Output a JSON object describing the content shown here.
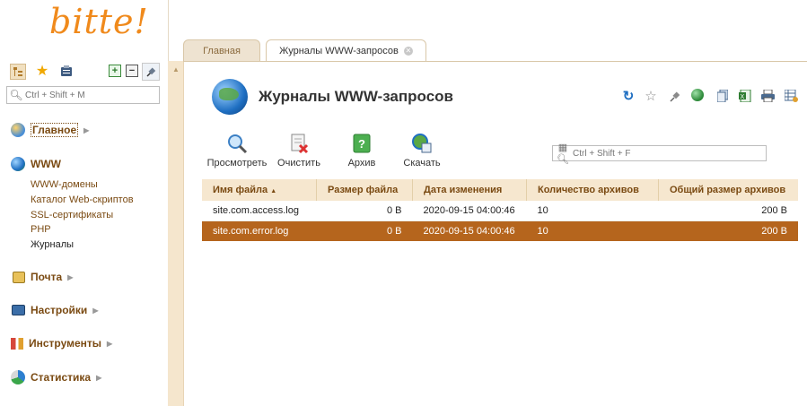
{
  "logo": "bitte!",
  "sidebar": {
    "search_placeholder": "Ctrl + Shift + M",
    "sections": [
      {
        "label": "Главное",
        "icon": "home-globe-icon"
      },
      {
        "label": "WWW",
        "icon": "globe-icon"
      },
      {
        "label": "Почта",
        "icon": "mail-icon"
      },
      {
        "label": "Настройки",
        "icon": "settings-monitor-icon"
      },
      {
        "label": "Инструменты",
        "icon": "tools-icon"
      },
      {
        "label": "Статистика",
        "icon": "pie-chart-icon"
      }
    ],
    "www_items": [
      "WWW-домены",
      "Каталог Web-скриптов",
      "SSL-сертификаты",
      "PHP",
      "Журналы"
    ]
  },
  "tabs": {
    "home": "Главная",
    "active": "Журналы WWW-запросов"
  },
  "page": {
    "title": "Журналы WWW-запросов"
  },
  "actions": [
    "Просмотреть",
    "Очистить",
    "Архив",
    "Скачать"
  ],
  "grid_search_placeholder": "Ctrl + Shift + F",
  "table": {
    "columns": [
      "Имя файла",
      "Размер файла",
      "Дата изменения",
      "Количество архивов",
      "Общий размер архивов"
    ],
    "sort_indicator": "▲",
    "rows": [
      {
        "name": "site.com.access.log",
        "size": "0 B",
        "modified": "2020-09-15 04:00:46",
        "archives": "10",
        "archives_size": "200 B"
      },
      {
        "name": "site.com.error.log",
        "size": "0 B",
        "modified": "2020-09-15 04:00:46",
        "archives": "10",
        "archives_size": "200 B"
      }
    ],
    "selected_row": 1
  },
  "colors": {
    "accent": "#b5651d",
    "section_text": "#7a4a12",
    "header_bg": "#f6e7cf",
    "strip_bg": "#f5e6cd"
  }
}
